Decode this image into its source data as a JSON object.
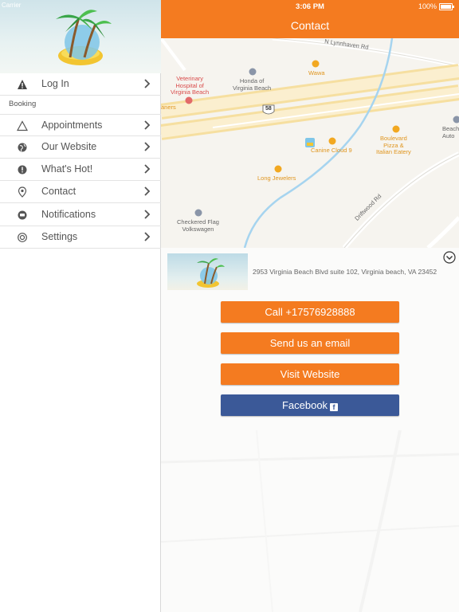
{
  "status_bar": {
    "carrier": "Carrier",
    "time": "3:06 PM",
    "battery": "100%"
  },
  "sidebar": {
    "login_label": "Log In",
    "section_label": "Booking",
    "items": [
      {
        "label": "Appointments",
        "icon": "triangle-icon"
      },
      {
        "label": "Our Website",
        "icon": "globe-icon"
      },
      {
        "label": "What's Hot!",
        "icon": "exclamation-icon"
      },
      {
        "label": "Contact",
        "icon": "location-pin-icon"
      },
      {
        "label": "Notifications",
        "icon": "chat-bubble-icon"
      },
      {
        "label": "Settings",
        "icon": "gear-icon"
      }
    ]
  },
  "header": {
    "title": "Contact"
  },
  "map": {
    "labels": {
      "street_lynnhaven": "N Lynnhaven Rd",
      "honda": "Honda of\nVirginia Beach",
      "wawa": "Wawa",
      "vet": "Veterinary\nHospital of\nVirginia Beach",
      "cleaners": "aners",
      "route": "58",
      "beach_auto": "Beach\nAuto",
      "boulevard": "Boulevard\nPizza &\nItalian Eatery",
      "canine": "Canine Cloud 9",
      "long": "Long Jewelers",
      "checkered": "Checkered Flag\nVolkswagen",
      "driftwood": "Driftwood Rd"
    }
  },
  "contact": {
    "address": "2953 Virginia Beach Blvd suite 102, Virginia beach, VA 23452"
  },
  "buttons": {
    "call": "Call +17576928888",
    "email": "Send us an email",
    "website": "Visit Website",
    "facebook": "Facebook"
  },
  "colors": {
    "accent": "#f47b20",
    "facebook": "#3b5998"
  }
}
